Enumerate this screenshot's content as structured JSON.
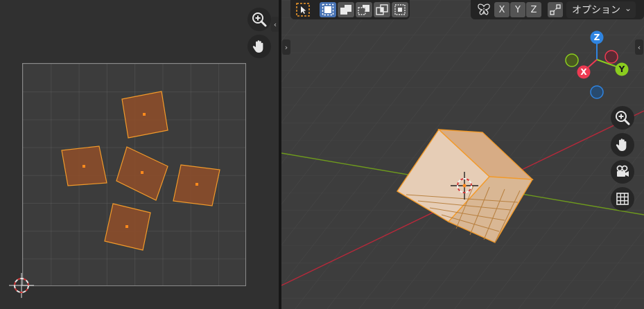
{
  "uv_editor": {
    "tools": [
      "zoom-icon",
      "pan-hand-icon"
    ],
    "grid": {
      "visible": true
    },
    "islands_count": 5,
    "colors": {
      "island_fill": "#8a4d2b",
      "island_edge": "#f29a2a",
      "background": "#303030",
      "grid": "#3c3c3c"
    }
  },
  "viewport": {
    "header": {
      "select_modes": [
        "select-box-icon",
        "select-new-icon",
        "select-extend-icon",
        "select-subtract-icon",
        "select-intersect-icon",
        "select-invert-icon"
      ],
      "mirror_icon": "butterfly-icon",
      "axes": [
        "X",
        "Y",
        "Z"
      ],
      "snap_icon": "snap-icon",
      "options_label": "オプション"
    },
    "gizmo": {
      "z": "Z",
      "x": "X",
      "y": "Y"
    },
    "nav_tools": [
      "zoom-icon",
      "pan-hand-icon",
      "camera-icon",
      "grid-icon"
    ],
    "colors": {
      "x_axis": "#ee3a52",
      "y_axis": "#8bcd1f",
      "z_axis": "#2f84e0",
      "selection": "#f29a2a",
      "cube_face": "#e1c5aa"
    }
  }
}
